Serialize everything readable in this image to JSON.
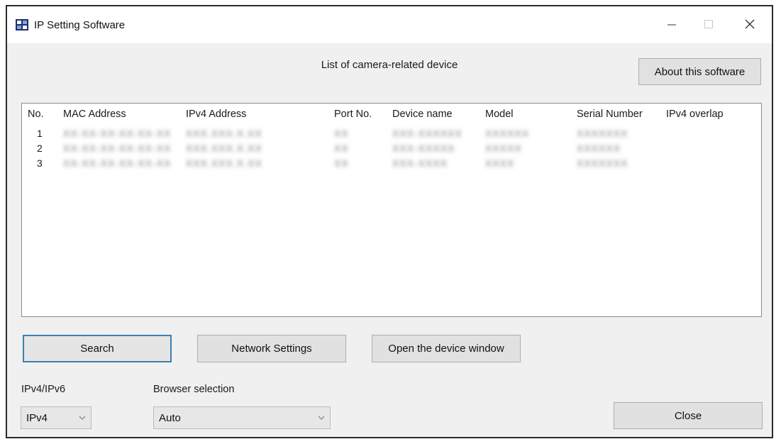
{
  "window": {
    "title": "IP Setting Software"
  },
  "header": {
    "list_title": "List of camera-related device",
    "about_label": "About this software"
  },
  "table": {
    "columns": [
      "No.",
      "MAC Address",
      "IPv4 Address",
      "Port No.",
      "Device name",
      "Model",
      "Serial Number",
      "IPv4 overlap"
    ],
    "rows": [
      {
        "no": "1",
        "mac": "XX-XX-XX-XX-XX-XX",
        "ipv4": "XXX.XXX.X.XX",
        "port": "XX",
        "device": "XXX-XXXXXX",
        "model": "XXXXXX",
        "serial": "XXXXXXX",
        "overlap": ""
      },
      {
        "no": "2",
        "mac": "XX-XX-XX-XX-XX-XX",
        "ipv4": "XXX.XXX.X.XX",
        "port": "XX",
        "device": "XXX-XXXXX",
        "model": "XXXXX",
        "serial": "XXXXXX",
        "overlap": ""
      },
      {
        "no": "3",
        "mac": "XX-XX-XX-XX-XX-XX",
        "ipv4": "XXX.XXX.X.XX",
        "port": "XX",
        "device": "XXX-XXXX",
        "model": "XXXX",
        "serial": "XXXXXXX",
        "overlap": ""
      }
    ]
  },
  "actions": {
    "search_label": "Search",
    "network_label": "Network Settings",
    "open_device_label": "Open the device window",
    "close_label": "Close"
  },
  "settings": {
    "ip_label": "IPv4/IPv6",
    "ip_value": "IPv4",
    "browser_label": "Browser selection",
    "browser_value": "Auto"
  },
  "icons": {
    "app": "camera-network-icon",
    "minimize": "minimize-icon",
    "maximize": "maximize-icon",
    "close": "close-icon",
    "dropdown": "chevron-down-icon"
  },
  "colors": {
    "default_button_border": "#3c7fb1",
    "window_bg": "#f0f0f0"
  }
}
